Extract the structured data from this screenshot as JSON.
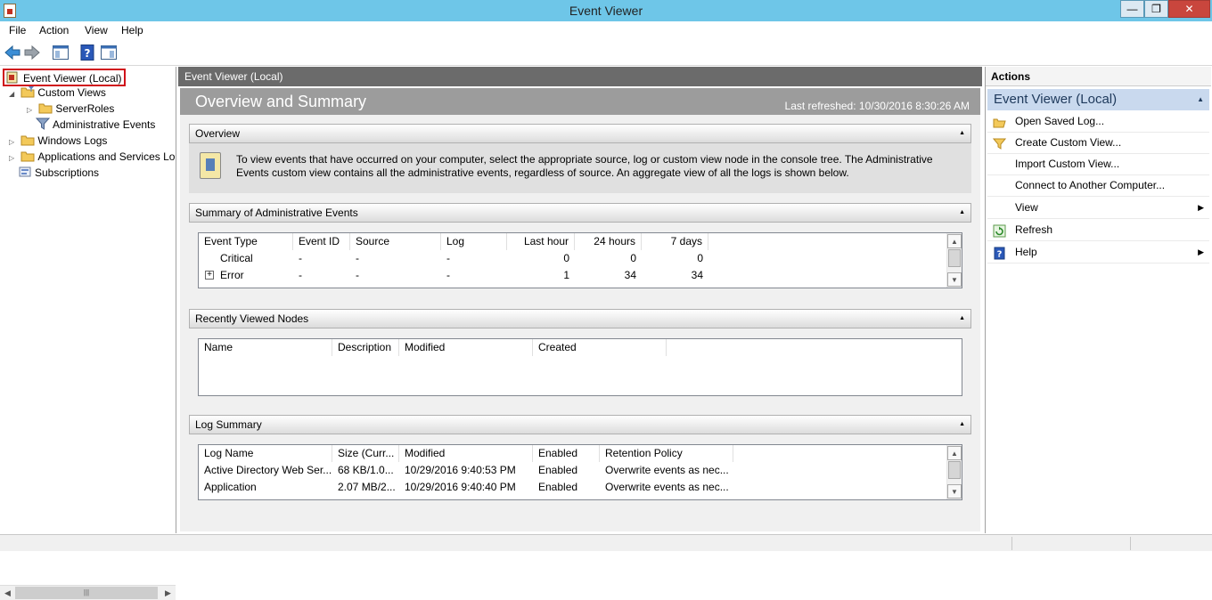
{
  "window": {
    "title": "Event Viewer"
  },
  "menu": [
    "File",
    "Action",
    "View",
    "Help"
  ],
  "tree": {
    "root": "Event Viewer (Local)",
    "custom_views": "Custom Views",
    "server_roles": "ServerRoles",
    "administrative_events": "Administrative Events",
    "windows_logs": "Windows Logs",
    "apps_services": "Applications and Services Lo",
    "subscriptions": "Subscriptions"
  },
  "center": {
    "header": "Event Viewer (Local)",
    "banner_title": "Overview and Summary",
    "last_refreshed": "Last refreshed: 10/30/2016 8:30:26 AM",
    "overview": {
      "title": "Overview",
      "text": "To view events that have occurred on your computer, select the appropriate source, log or custom view node in the console tree. The Administrative Events custom view contains all the administrative events, regardless of source. An aggregate view of all the logs is shown below."
    },
    "summary": {
      "title": "Summary of Administrative Events",
      "columns": [
        "Event Type",
        "Event ID",
        "Source",
        "Log",
        "Last hour",
        "24 hours",
        "7 days"
      ],
      "rows": [
        [
          "Critical",
          "-",
          "-",
          "-",
          "0",
          "0",
          "0"
        ],
        [
          "Error",
          "-",
          "-",
          "-",
          "1",
          "34",
          "34"
        ]
      ]
    },
    "recent": {
      "title": "Recently Viewed Nodes",
      "columns": [
        "Name",
        "Description",
        "Modified",
        "Created"
      ]
    },
    "log_summary": {
      "title": "Log Summary",
      "columns": [
        "Log Name",
        "Size (Curr...",
        "Modified",
        "Enabled",
        "Retention Policy"
      ],
      "rows": [
        [
          "Active Directory Web Ser...",
          "68 KB/1.0...",
          "10/29/2016 9:40:53 PM",
          "Enabled",
          "Overwrite events as nec..."
        ],
        [
          "Application",
          "2.07 MB/2...",
          "10/29/2016 9:40:40 PM",
          "Enabled",
          "Overwrite events as nec..."
        ]
      ]
    }
  },
  "actions": {
    "header": "Actions",
    "subheader": "Event Viewer (Local)",
    "items": [
      "Open Saved Log...",
      "Create Custom View...",
      "Import Custom View...",
      "Connect to Another Computer...",
      "View",
      "Refresh",
      "Help"
    ]
  }
}
